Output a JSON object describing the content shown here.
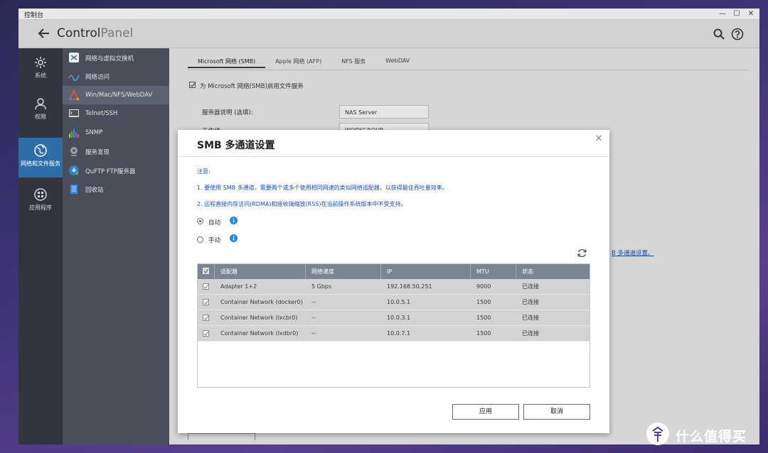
{
  "window": {
    "title": "控制台",
    "controls": [
      "—",
      "☐",
      "✕"
    ]
  },
  "header": {
    "title_strong": "Control",
    "title_light": "Panel"
  },
  "leftnav": [
    {
      "label": "系统",
      "icon": "gear-icon"
    },
    {
      "label": "权限",
      "icon": "user-icon"
    },
    {
      "label": "网络和文件服务",
      "icon": "globe-icon",
      "active": true
    },
    {
      "label": "应用程序",
      "icon": "apps-icon"
    }
  ],
  "subnav": [
    {
      "label": "网络与虚拟交换机",
      "icon": "network-switch-icon"
    },
    {
      "label": "网络访问",
      "icon": "network-access-icon"
    },
    {
      "label": "Win/Mac/NFS/WebDAV",
      "icon": "file-share-icon",
      "active": true
    },
    {
      "label": "Telnet/SSH",
      "icon": "terminal-icon"
    },
    {
      "label": "SNMP",
      "icon": "snmp-icon"
    },
    {
      "label": "服务发现",
      "icon": "discovery-icon"
    },
    {
      "label": "QuFTP FTP服务器",
      "icon": "ftp-icon"
    },
    {
      "label": "回收站",
      "icon": "recycle-bin-icon"
    }
  ],
  "tabs": [
    "Microsoft 网络 (SMB)",
    "Apple 网络 (AFP)",
    "NFS 服务",
    "WebDAV"
  ],
  "background_form": {
    "enable_label": "为 Microsoft 网络(SMB)启用文件服务",
    "server_desc_label": "服务器说明 (选填):",
    "server_desc_value": "NAS Server",
    "workgroup_label": "工作组:",
    "workgroup_value": "WORKGROUP",
    "multichannel_link": "B 多通道设置。"
  },
  "modal": {
    "title": "SMB 多通道设置",
    "note_title": "注意:",
    "note_1": "1. 要使用 SMB 多通道，需要两个或多个使用相同网速的类似网络适配器，以获得最佳吞吐量效率。",
    "note_2": "2. 远程直接内存访问(RDMA)和接收端缩放(RSS)在当前操作系统版本中不受支持。",
    "radio_auto": "自动",
    "radio_manual": "手动",
    "columns": [
      "适配器",
      "网络速度",
      "IP",
      "MTU",
      "状态"
    ],
    "rows": [
      {
        "adapter": "Adapter 1+2",
        "speed": "5 Gbps",
        "ip": "192.168.50.251",
        "mtu": "9000",
        "status": "已连接"
      },
      {
        "adapter": "Container Network (docker0)",
        "speed": "--",
        "ip": "10.0.5.1",
        "mtu": "1500",
        "status": "已连接"
      },
      {
        "adapter": "Container Network (lxcbr0)",
        "speed": "--",
        "ip": "10.0.3.1",
        "mtu": "1500",
        "status": "已连接"
      },
      {
        "adapter": "Container Network (lxdbr0)",
        "speed": "--",
        "ip": "10.0.7.1",
        "mtu": "1500",
        "status": "已连接"
      }
    ],
    "apply_label": "应用",
    "cancel_label": "取消",
    "accent": "#1c4fb8",
    "info_color": "#1a8be8"
  },
  "watermark": {
    "text": "什么值得买"
  }
}
